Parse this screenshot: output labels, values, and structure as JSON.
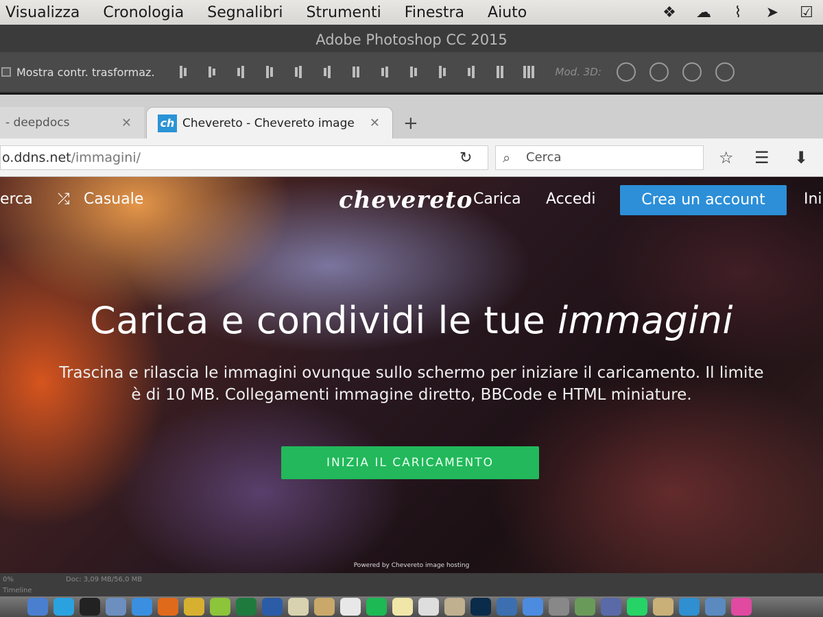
{
  "menubar": {
    "items": [
      "Visualizza",
      "Cronologia",
      "Segnalibri",
      "Strumenti",
      "Finestra",
      "Aiuto"
    ]
  },
  "photoshop": {
    "title": "Adobe Photoshop CC 2015",
    "show_transform_label": "Mostra contr. trasformaz.",
    "mode_3d_label": "Mod. 3D:",
    "status_zoom": "0%",
    "status_doc": "Doc: 3,09 MB/56,0 MB",
    "status_tab": "Timeline"
  },
  "browser": {
    "tabs": [
      {
        "label": "- deepdocs",
        "active": false
      },
      {
        "label": "Chevereto - Chevereto image",
        "active": true
      }
    ],
    "favicon_text": "ch",
    "url_dim": "o.ddns.net",
    "url_path": "/immagini/",
    "search_placeholder": "Cerca"
  },
  "site": {
    "nav_search": "erca",
    "nav_random": "Casuale",
    "logo": "chevereto",
    "nav_upload": "Carica",
    "nav_login": "Accedi",
    "nav_signup": "Crea un account",
    "nav_more": "Ini",
    "headline_main": "Carica e condividi le tue ",
    "headline_em": "immagini",
    "description": "Trascina e rilascia le immagini ovunque sullo schermo per iniziare il caricamento. Il limite è di 10 MB. Collegamenti immagine diretto, BBCode e HTML miniature.",
    "start_button": "INIZIA IL CARICAMENTO",
    "powered_by": "Powered by Chevereto image hosting"
  },
  "colors": {
    "cta_blue": "#2c8fd8",
    "start_green": "#22b85b"
  }
}
